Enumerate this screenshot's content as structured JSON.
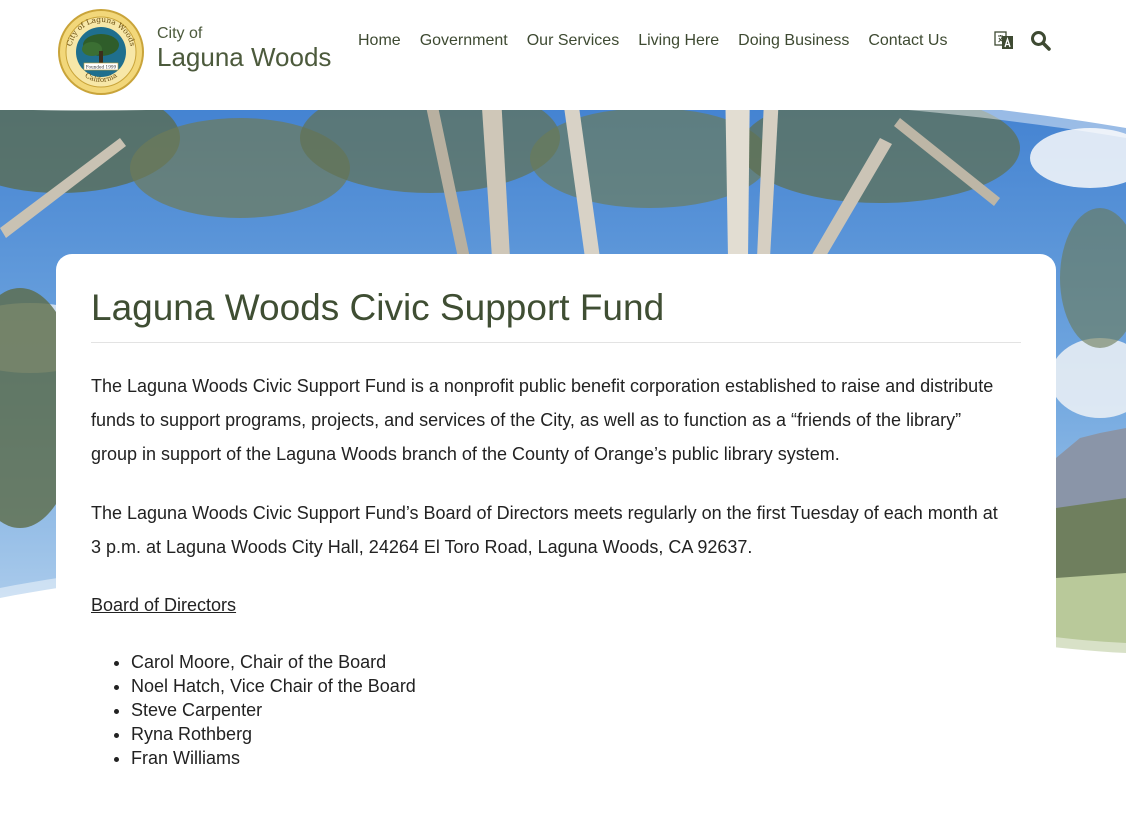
{
  "header": {
    "seal": {
      "ring_top_text": "City of Laguna Woods",
      "ring_bottom_text": "California",
      "banner_text": "Founded 1999",
      "colors": {
        "ring": "#e9c450",
        "inner": "#1f6f8e",
        "tree": "#2f5d2a"
      }
    },
    "brand": {
      "line1": "City of",
      "line2": "Laguna Woods"
    },
    "nav": [
      {
        "label": "Home"
      },
      {
        "label": "Government"
      },
      {
        "label": "Our Services"
      },
      {
        "label": "Living Here"
      },
      {
        "label": "Doing Business"
      },
      {
        "label": "Contact Us"
      }
    ],
    "icons": {
      "translate": "translate-icon",
      "search": "search-icon"
    }
  },
  "hero": {
    "image": "eucalyptus-trees-blue-sky"
  },
  "main": {
    "title": "Laguna Woods Civic Support Fund",
    "paragraphs": [
      "The Laguna Woods Civic Support Fund is a nonprofit public benefit corporation established to raise and distribute funds to support programs, projects, and services of the City, as well as to function as a “friends of the library” group in support of the Laguna Woods branch of the County of Orange’s public library system.",
      "The Laguna Woods Civic Support Fund’s Board of Directors meets regularly on the first Tuesday of each month at 3 p.m. at Laguna Woods City Hall, 24264 El Toro Road, Laguna Woods, CA 92637."
    ],
    "board_heading": "Board of Directors",
    "board_members": [
      "Carol Moore, Chair of the Board",
      "Noel Hatch, Vice Chair of the Board",
      "Steve Carpenter",
      "Ryna Rothberg",
      "Fran Williams"
    ]
  },
  "colors": {
    "title": "#3f4e33",
    "nav": "#3e4a32",
    "body_text": "#222222"
  }
}
